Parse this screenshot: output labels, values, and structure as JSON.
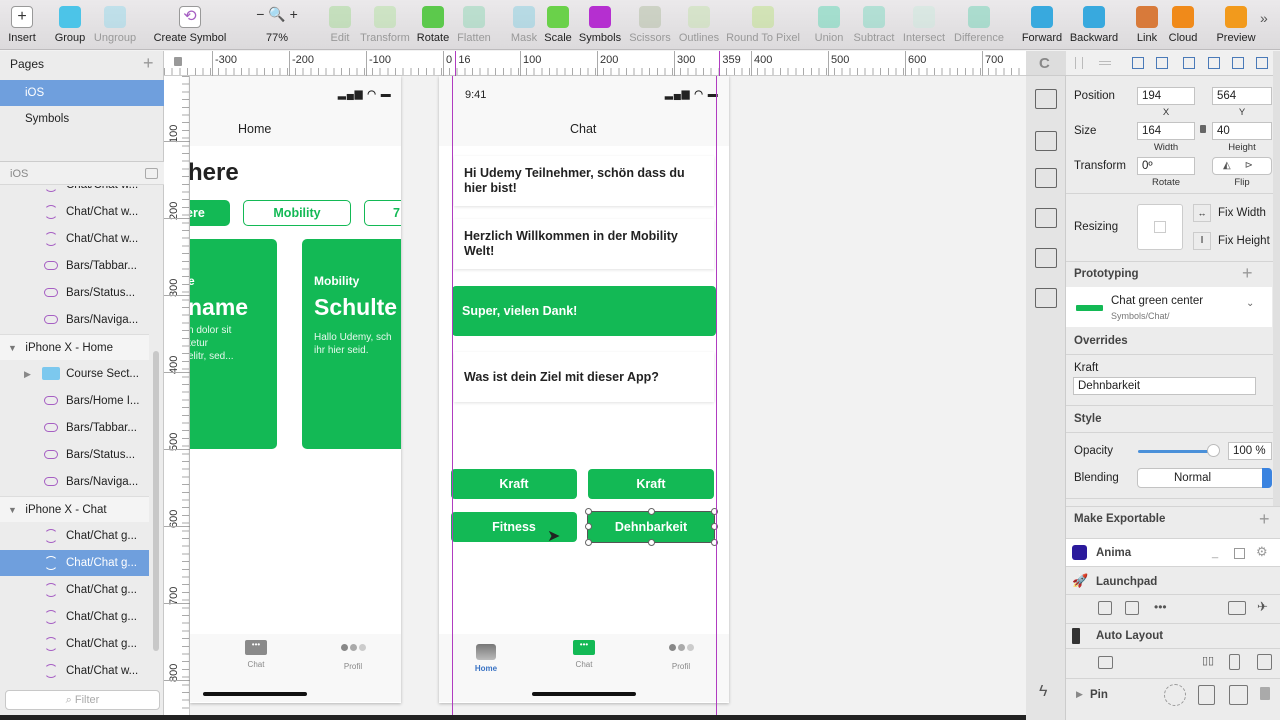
{
  "toolbar": {
    "items": [
      {
        "label": "Insert",
        "icon": "plus-icon",
        "enabled": true
      },
      {
        "label": "Group",
        "icon": "group-icon",
        "enabled": true
      },
      {
        "label": "Ungroup",
        "icon": "ungroup-icon",
        "enabled": false
      },
      {
        "label": "Create Symbol",
        "icon": "symbol-icon",
        "enabled": true
      },
      {
        "label": "77%",
        "icon": "zoom-icon",
        "enabled": true
      },
      {
        "label": "Edit",
        "icon": "edit-icon",
        "enabled": false
      },
      {
        "label": "Transform",
        "icon": "transform-icon",
        "enabled": false
      },
      {
        "label": "Rotate",
        "icon": "rotate-icon",
        "enabled": true
      },
      {
        "label": "Flatten",
        "icon": "flatten-icon",
        "enabled": false
      },
      {
        "label": "Mask",
        "icon": "mask-icon",
        "enabled": false
      },
      {
        "label": "Scale",
        "icon": "scale-icon",
        "enabled": true
      },
      {
        "label": "Symbols",
        "icon": "symbols-icon",
        "enabled": true
      },
      {
        "label": "Scissors",
        "icon": "scissors-icon",
        "enabled": false
      },
      {
        "label": "Outlines",
        "icon": "outlines-icon",
        "enabled": false
      },
      {
        "label": "Round To Pixel",
        "icon": "grid-icon",
        "enabled": false
      },
      {
        "label": "Union",
        "icon": "union-icon",
        "enabled": false
      },
      {
        "label": "Subtract",
        "icon": "subtract-icon",
        "enabled": false
      },
      {
        "label": "Intersect",
        "icon": "intersect-icon",
        "enabled": false
      },
      {
        "label": "Difference",
        "icon": "difference-icon",
        "enabled": false
      },
      {
        "label": "Forward",
        "icon": "forward-icon",
        "enabled": true
      },
      {
        "label": "Backward",
        "icon": "backward-icon",
        "enabled": true
      },
      {
        "label": "Link",
        "icon": "link-icon",
        "enabled": true
      },
      {
        "label": "Cloud",
        "icon": "cloud-icon",
        "enabled": true
      },
      {
        "label": "Preview",
        "icon": "play-icon",
        "enabled": true
      }
    ],
    "more": "»"
  },
  "pages": {
    "title": "Pages",
    "items": [
      {
        "label": "iOS",
        "selected": true
      },
      {
        "label": "Symbols",
        "selected": false
      }
    ]
  },
  "layers": {
    "page": "iOS",
    "items": [
      {
        "label": "Chat/Chat w...",
        "type": "symbol",
        "indent": 2
      },
      {
        "label": "Chat/Chat w...",
        "type": "symbol",
        "indent": 2
      },
      {
        "label": "Chat/Chat w...",
        "type": "symbol",
        "indent": 2
      },
      {
        "label": "Bars/Tabbar...",
        "type": "bar",
        "indent": 2
      },
      {
        "label": "Bars/Status...",
        "type": "bar",
        "indent": 2
      },
      {
        "label": "Bars/Naviga...",
        "type": "bar",
        "indent": 2
      },
      {
        "label": "iPhone X - Home",
        "type": "artboard",
        "indent": 0
      },
      {
        "label": "Course Sect...",
        "type": "folder",
        "indent": 1
      },
      {
        "label": "Bars/Home I...",
        "type": "bar",
        "indent": 2
      },
      {
        "label": "Bars/Tabbar...",
        "type": "bar",
        "indent": 2
      },
      {
        "label": "Bars/Status...",
        "type": "bar",
        "indent": 2
      },
      {
        "label": "Bars/Naviga...",
        "type": "bar",
        "indent": 2
      },
      {
        "label": "iPhone X - Chat",
        "type": "artboard",
        "indent": 0
      },
      {
        "label": "Chat/Chat g...",
        "type": "symbol",
        "indent": 2
      },
      {
        "label": "Chat/Chat g...",
        "type": "symbol",
        "indent": 2,
        "selected": true
      },
      {
        "label": "Chat/Chat g...",
        "type": "symbol",
        "indent": 2
      },
      {
        "label": "Chat/Chat g...",
        "type": "symbol",
        "indent": 2
      },
      {
        "label": "Chat/Chat g...",
        "type": "symbol",
        "indent": 2
      },
      {
        "label": "Chat/Chat w...",
        "type": "symbol",
        "indent": 2
      }
    ],
    "filter_placeholder": "Filter"
  },
  "rulers": {
    "top": [
      "-300",
      "-200",
      "-100",
      "0",
      "16",
      "100",
      "200",
      "300",
      "359",
      "400",
      "500",
      "600",
      "700"
    ],
    "left": [
      "100",
      "200",
      "300",
      "400",
      "500",
      "600",
      "700",
      "800"
    ]
  },
  "home": {
    "title": "Home",
    "heading": "here",
    "chips": [
      "ere",
      "Mobility",
      "7 I"
    ],
    "cards": [
      {
        "cat": "e",
        "title": "name",
        "body": "n dolor sit\ntetur\nelitr, sed..."
      },
      {
        "cat": "Mobility",
        "title": "Schulte",
        "body": "Hallo Udemy, sch\nihr hier seid."
      }
    ],
    "tabs": [
      "Chat",
      "Profil"
    ]
  },
  "chat": {
    "time": "9:41",
    "title": "Chat",
    "messages": [
      {
        "text": "Hi Udemy Teilnehmer, schön dass du hier bist!",
        "green": false
      },
      {
        "text": "Herzlich Willkommen in der Mobility Welt!",
        "green": false
      },
      {
        "text": "Super, vielen Dank!",
        "green": true
      },
      {
        "text": "Was ist dein Ziel mit dieser App?",
        "green": false
      }
    ],
    "options": [
      "Kraft",
      "Kraft",
      "Fitness",
      "Dehnbarkeit"
    ],
    "tabs": [
      "Home",
      "Chat",
      "Profil"
    ]
  },
  "inspector": {
    "position": {
      "label": "Position",
      "x": "194",
      "y": "564",
      "x_label": "X",
      "y_label": "Y"
    },
    "size": {
      "label": "Size",
      "width": "164",
      "height": "40",
      "w_label": "Width",
      "h_label": "Height"
    },
    "transform": {
      "label": "Transform",
      "rotate": "0º",
      "rotate_label": "Rotate",
      "flip_label": "Flip"
    },
    "resizing": {
      "label": "Resizing",
      "fix_width": "Fix Width",
      "fix_height": "Fix Height"
    },
    "prototyping": "Prototyping",
    "symbol": {
      "name": "Chat green center",
      "path": "Symbols/Chat/"
    },
    "overrides": {
      "title": "Overrides",
      "field_label": "Kraft",
      "value": "Dehnbarkeit"
    },
    "style": {
      "title": "Style",
      "opacity_label": "Opacity",
      "opacity": 100,
      "opacity_text": "100 %",
      "blending_label": "Blending",
      "blending": "Normal"
    },
    "export": "Make Exportable",
    "plugins": [
      "Anima",
      "Launchpad",
      "Auto Layout",
      "Pin"
    ]
  },
  "colors": {
    "accent_green": "#13b955",
    "selection": "#6f9fdd",
    "artboard_guide": "#b03cc0"
  }
}
